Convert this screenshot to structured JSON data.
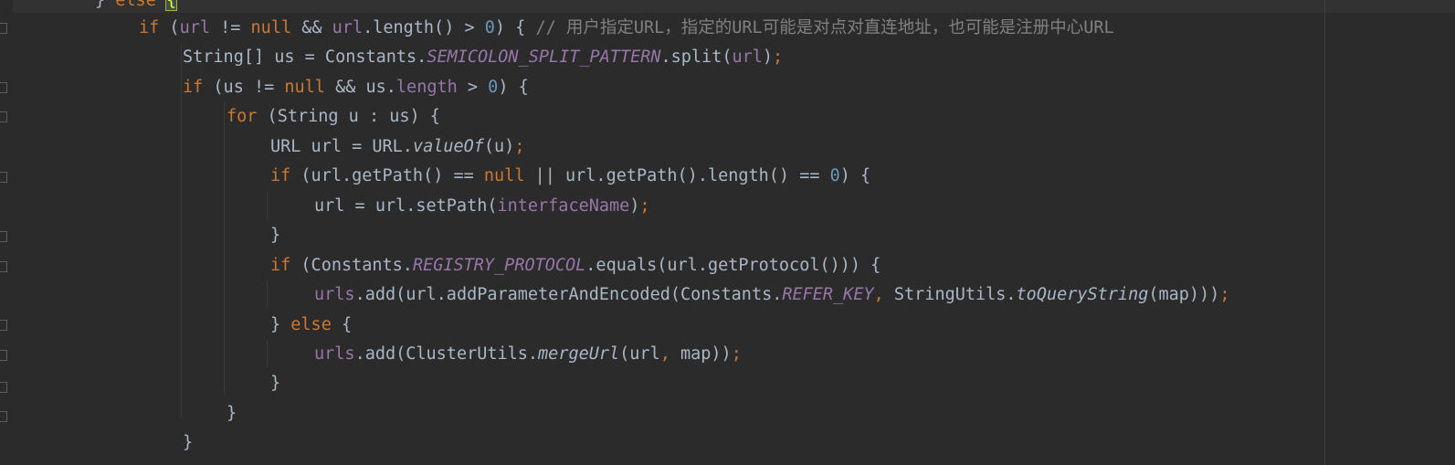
{
  "editor": {
    "colors": {
      "background": "#2b2b2b",
      "keyword": "#cc7832",
      "number": "#6897bb",
      "field": "#9876aa",
      "text": "#a9b7c6",
      "comment": "#808080"
    },
    "lines": [
      {
        "tokens": [
          {
            "t": "} ",
            "c": "text"
          },
          {
            "t": "else",
            "c": "kw"
          },
          {
            "t": " ",
            "c": "text"
          },
          {
            "t": "{",
            "c": "caret"
          }
        ]
      },
      {
        "tokens": [
          {
            "t": "if",
            "c": "kw"
          },
          {
            "t": " (",
            "c": "text"
          },
          {
            "t": "url",
            "c": "field"
          },
          {
            "t": " != ",
            "c": "text"
          },
          {
            "t": "null",
            "c": "kw"
          },
          {
            "t": " && ",
            "c": "text"
          },
          {
            "t": "url",
            "c": "field"
          },
          {
            "t": ".length() > ",
            "c": "text"
          },
          {
            "t": "0",
            "c": "num"
          },
          {
            "t": ") { ",
            "c": "text"
          },
          {
            "t": "// 用户指定URL，指定的URL可能是对点对直连地址，也可能是注册中心URL",
            "c": "comment"
          }
        ]
      },
      {
        "tokens": [
          {
            "t": "String[] us = Constants.",
            "c": "text"
          },
          {
            "t": "SEMICOLON_SPLIT_PATTERN",
            "c": "static"
          },
          {
            "t": ".split(",
            "c": "text"
          },
          {
            "t": "url",
            "c": "field"
          },
          {
            "t": ")",
            "c": "text"
          },
          {
            "t": ";",
            "c": "semi"
          }
        ]
      },
      {
        "tokens": [
          {
            "t": "if",
            "c": "kw"
          },
          {
            "t": " (us != ",
            "c": "text"
          },
          {
            "t": "null",
            "c": "kw"
          },
          {
            "t": " && us.",
            "c": "text"
          },
          {
            "t": "length",
            "c": "field"
          },
          {
            "t": " > ",
            "c": "text"
          },
          {
            "t": "0",
            "c": "num"
          },
          {
            "t": ") {",
            "c": "text"
          }
        ]
      },
      {
        "tokens": [
          {
            "t": "for",
            "c": "kw"
          },
          {
            "t": " (String u : us) {",
            "c": "text"
          }
        ]
      },
      {
        "tokens": [
          {
            "t": "URL url = URL.",
            "c": "text"
          },
          {
            "t": "valueOf",
            "c": "mstatic"
          },
          {
            "t": "(u)",
            "c": "text"
          },
          {
            "t": ";",
            "c": "semi"
          }
        ]
      },
      {
        "tokens": [
          {
            "t": "if",
            "c": "kw"
          },
          {
            "t": " (url.getPath() == ",
            "c": "text"
          },
          {
            "t": "null",
            "c": "kw"
          },
          {
            "t": " || url.getPath().length() == ",
            "c": "text"
          },
          {
            "t": "0",
            "c": "num"
          },
          {
            "t": ") {",
            "c": "text"
          }
        ]
      },
      {
        "tokens": [
          {
            "t": "url = url.setPath(",
            "c": "text"
          },
          {
            "t": "interfaceName",
            "c": "field"
          },
          {
            "t": ")",
            "c": "text"
          },
          {
            "t": ";",
            "c": "semi"
          }
        ]
      },
      {
        "tokens": [
          {
            "t": "}",
            "c": "text"
          }
        ]
      },
      {
        "tokens": [
          {
            "t": "if",
            "c": "kw"
          },
          {
            "t": " (Constants.",
            "c": "text"
          },
          {
            "t": "REGISTRY_PROTOCOL",
            "c": "static"
          },
          {
            "t": ".equals(url.getProtocol())) {",
            "c": "text"
          }
        ]
      },
      {
        "tokens": [
          {
            "t": "urls",
            "c": "field"
          },
          {
            "t": ".add(url.addParameterAndEncoded(Constants.",
            "c": "text"
          },
          {
            "t": "REFER_KEY",
            "c": "static"
          },
          {
            "t": ", ",
            "c": "semi"
          },
          {
            "t": "StringUtils.",
            "c": "text"
          },
          {
            "t": "toQueryString",
            "c": "mstatic"
          },
          {
            "t": "(map)))",
            "c": "text"
          },
          {
            "t": ";",
            "c": "semi"
          }
        ]
      },
      {
        "tokens": [
          {
            "t": "} ",
            "c": "text"
          },
          {
            "t": "else",
            "c": "kw"
          },
          {
            "t": " {",
            "c": "text"
          }
        ]
      },
      {
        "tokens": [
          {
            "t": "urls",
            "c": "field"
          },
          {
            "t": ".add(ClusterUtils.",
            "c": "text"
          },
          {
            "t": "mergeUrl",
            "c": "mstatic"
          },
          {
            "t": "(url",
            "c": "text"
          },
          {
            "t": ", ",
            "c": "semi"
          },
          {
            "t": "map))",
            "c": "text"
          },
          {
            "t": ";",
            "c": "semi"
          }
        ]
      },
      {
        "tokens": [
          {
            "t": "}",
            "c": "text"
          }
        ]
      },
      {
        "tokens": [
          {
            "t": "}",
            "c": "text"
          }
        ]
      },
      {
        "tokens": [
          {
            "t": "}",
            "c": "text"
          }
        ]
      }
    ]
  }
}
